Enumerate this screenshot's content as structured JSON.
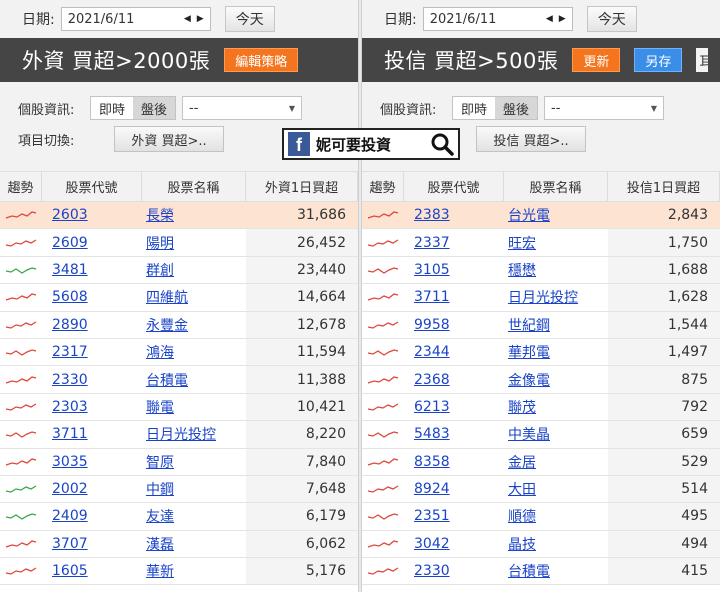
{
  "left": {
    "date_label": "日期:",
    "date_value": "2021/6/11",
    "today_label": "今天",
    "title": "外資 買超>2000張",
    "edit_strategy_label": "編輯策略",
    "info_label": "個股資訊:",
    "seg_realtime": "即時",
    "seg_after": "盤後",
    "select_value": "--",
    "switch_label": "項目切換:",
    "switch_value": "外資 買超>..",
    "columns": [
      "趨勢",
      "股票代號",
      "股票名稱",
      "外資1日買超"
    ],
    "rows": [
      {
        "code": "2603",
        "name": "長榮",
        "value": "31,686",
        "trend": "red",
        "highlight": true
      },
      {
        "code": "2609",
        "name": "陽明",
        "value": "26,452",
        "trend": "red"
      },
      {
        "code": "3481",
        "name": "群創",
        "value": "23,440",
        "trend": "green"
      },
      {
        "code": "5608",
        "name": "四維航",
        "value": "14,664",
        "trend": "red"
      },
      {
        "code": "2890",
        "name": "永豐金",
        "value": "12,678",
        "trend": "red"
      },
      {
        "code": "2317",
        "name": "鴻海",
        "value": "11,594",
        "trend": "red"
      },
      {
        "code": "2330",
        "name": "台積電",
        "value": "11,388",
        "trend": "red"
      },
      {
        "code": "2303",
        "name": "聯電",
        "value": "10,421",
        "trend": "red"
      },
      {
        "code": "3711",
        "name": "日月光投控",
        "value": "8,220",
        "trend": "red"
      },
      {
        "code": "3035",
        "name": "智原",
        "value": "7,840",
        "trend": "red"
      },
      {
        "code": "2002",
        "name": "中鋼",
        "value": "7,648",
        "trend": "green"
      },
      {
        "code": "2409",
        "name": "友達",
        "value": "6,179",
        "trend": "green"
      },
      {
        "code": "3707",
        "name": "漢磊",
        "value": "6,062",
        "trend": "red"
      },
      {
        "code": "1605",
        "name": "華新",
        "value": "5,176",
        "trend": "red"
      }
    ]
  },
  "right": {
    "date_label": "日期:",
    "date_value": "2021/6/11",
    "today_label": "今天",
    "title": "投信 買超>500張",
    "update_label": "更新",
    "save_as_label": "另存",
    "cut_label": "耳",
    "info_label": "個股資訊:",
    "seg_realtime": "即時",
    "seg_after": "盤後",
    "select_value": "--",
    "switch_label": "項目切換:",
    "switch_value": "投信 買超>..",
    "columns": [
      "趨勢",
      "股票代號",
      "股票名稱",
      "投信1日買超"
    ],
    "rows": [
      {
        "code": "2383",
        "name": "台光電",
        "value": "2,843",
        "trend": "red",
        "highlight": true
      },
      {
        "code": "2337",
        "name": "旺宏",
        "value": "1,750",
        "trend": "red"
      },
      {
        "code": "3105",
        "name": "穩懋",
        "value": "1,688",
        "trend": "red"
      },
      {
        "code": "3711",
        "name": "日月光投控",
        "value": "1,628",
        "trend": "red"
      },
      {
        "code": "9958",
        "name": "世紀鋼",
        "value": "1,544",
        "trend": "red"
      },
      {
        "code": "2344",
        "name": "華邦電",
        "value": "1,497",
        "trend": "red"
      },
      {
        "code": "2368",
        "name": "金像電",
        "value": "875",
        "trend": "red"
      },
      {
        "code": "6213",
        "name": "聯茂",
        "value": "792",
        "trend": "red"
      },
      {
        "code": "5483",
        "name": "中美晶",
        "value": "659",
        "trend": "red"
      },
      {
        "code": "8358",
        "name": "金居",
        "value": "529",
        "trend": "red"
      },
      {
        "code": "8924",
        "name": "大田",
        "value": "514",
        "trend": "red"
      },
      {
        "code": "2351",
        "name": "順德",
        "value": "495",
        "trend": "red"
      },
      {
        "code": "3042",
        "name": "晶技",
        "value": "494",
        "trend": "red"
      },
      {
        "code": "2330",
        "name": "台積電",
        "value": "415",
        "trend": "red"
      }
    ]
  },
  "watermark": {
    "fb_glyph": "f",
    "text": "妮可要投資",
    "icon": "search-icon"
  },
  "colors": {
    "title_bar": "#454545",
    "accent_orange": "#f5751f",
    "accent_blue": "#3b8ee8",
    "highlight_row": "#fde3d2",
    "link": "#1a44c8",
    "trend_red": "#e0463a",
    "trend_green": "#3aa54a",
    "facebook": "#3b5998"
  }
}
